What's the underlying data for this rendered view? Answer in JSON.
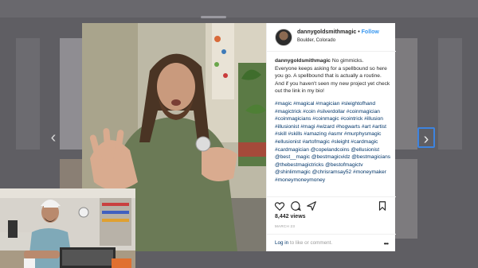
{
  "post": {
    "username": "dannygoldsmithmagic",
    "separator": " • ",
    "follow_label": "Follow",
    "location": "Boulder, Colorado",
    "caption_user": "dannygoldsmithmagic",
    "caption_text": "No gimmicks.",
    "caption_line2": "Everyone keeps asking for a spellbound so here you go. A spellbound that is actually a routine.",
    "caption_line3": "And if you haven't seen my new project yet check out the link in my bio!",
    "hashtags": "#magic #magical #magician #sleightofhand #magictrick #coin #silverdollar #coinmagician #coinmagicians #coinmagic #cointrick #illusion #illusionist #magi #wizard #hogwarts #art #artist #skill #skills #amazing #asmr #murphysmagic #ellusionist #artofmagic #sleight #cardmagic #cardmagician @copelandcoins @ellusionist @best__magic @bestmagicvidz @bestmagicians @thebestmagictricks @bestofmagictv @shinlimmagic @chrisramsay52 #moneymaker #moneymoneymoney",
    "views": "8,442 views",
    "date": "MARCH 23",
    "login_link": "Log in",
    "comment_prompt": " to like or comment.",
    "more_label": "•••"
  },
  "nav": {
    "prev": "‹",
    "next": "›"
  },
  "icons": {
    "like": "heart-icon",
    "comment": "comment-icon",
    "share": "share-icon",
    "save": "bookmark-icon",
    "more": "more-options-icon"
  },
  "colors": {
    "follow": "#3897f0",
    "link": "#003569",
    "muted": "#999999",
    "backdrop": "#5f5e63",
    "focus_ring": "#3d84e0"
  }
}
